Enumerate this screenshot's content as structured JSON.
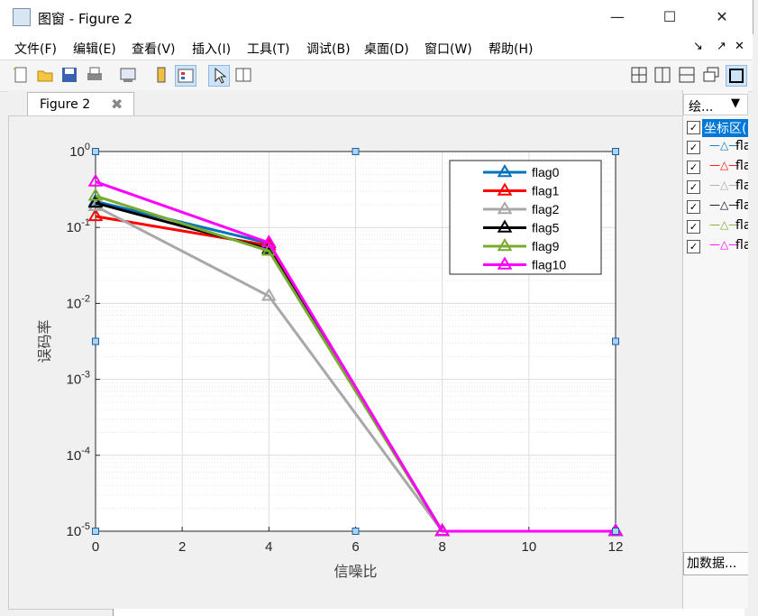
{
  "window": {
    "title": "图窗 - Figure 2"
  },
  "menu": [
    {
      "label": "文件(F)"
    },
    {
      "label": "编辑(E)"
    },
    {
      "label": "查看(V)"
    },
    {
      "label": "插入(I)"
    },
    {
      "label": "工具(T)"
    },
    {
      "label": "调试(B)"
    },
    {
      "label": "桌面(D)"
    },
    {
      "label": "窗口(W)"
    },
    {
      "label": "帮助(H)"
    }
  ],
  "tab": {
    "label": "Figure 2"
  },
  "side_panel": {
    "header": "绘...",
    "root_label": "坐标区(",
    "items": [
      "fla",
      "fla",
      "fla",
      "fla",
      "fla",
      "fla"
    ],
    "button": "加数据..."
  },
  "chart_data": {
    "type": "line",
    "xlabel": "信噪比",
    "ylabel": "误码率",
    "xlim": [
      0,
      12
    ],
    "ylim": [
      1e-05,
      1
    ],
    "yscale": "log",
    "grid": true,
    "minor_grid": true,
    "legend_position": "top-right",
    "x_ticks": [
      "0",
      "2",
      "4",
      "6",
      "8",
      "10",
      "12"
    ],
    "y_tick_exponents": [
      "0",
      "-1",
      "-2",
      "-3",
      "-4",
      "-5"
    ],
    "series": [
      {
        "name": "flag0",
        "color": "#0072bd",
        "x": [
          0,
          4,
          8,
          12
        ],
        "y": [
          0.22,
          0.062,
          1e-05,
          1e-05
        ]
      },
      {
        "name": "flag1",
        "color": "#ff0000",
        "x": [
          0,
          4,
          8,
          12
        ],
        "y": [
          0.14,
          0.058,
          1e-05,
          1e-05
        ]
      },
      {
        "name": "flag2",
        "color": "#a8a8a8",
        "x": [
          0,
          4,
          8,
          12
        ],
        "y": [
          0.19,
          0.0125,
          1e-05,
          1e-05
        ]
      },
      {
        "name": "flag5",
        "color": "#000000",
        "x": [
          0,
          4,
          8,
          12
        ],
        "y": [
          0.21,
          0.052,
          1e-05,
          1e-05
        ]
      },
      {
        "name": "flag9",
        "color": "#77ac30",
        "x": [
          0,
          4,
          8,
          12
        ],
        "y": [
          0.26,
          0.049,
          1e-05,
          1e-05
        ]
      },
      {
        "name": "flag10",
        "color": "#ff00ff",
        "x": [
          0,
          4,
          8,
          12
        ],
        "y": [
          0.4,
          0.063,
          1e-05,
          1e-05
        ]
      }
    ]
  }
}
